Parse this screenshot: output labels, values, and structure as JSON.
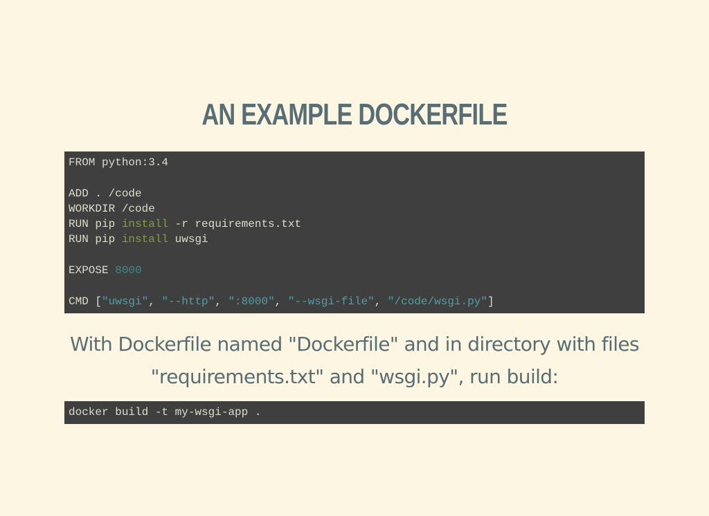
{
  "slide": {
    "title": "AN EXAMPLE DOCKERFILE",
    "paragraph": "With Dockerfile named \"Dockerfile\" and in directory with files \"requirements.txt\" and \"wsgi.py\", run build:"
  },
  "dockerfile": {
    "line1": "FROM python:3.4",
    "line3": "ADD . /code",
    "line4": "WORKDIR /code",
    "line5_a": "RUN pip ",
    "line5_b": "install",
    "line5_c": " -r requirements.txt",
    "line6_a": "RUN pip ",
    "line6_b": "install",
    "line6_c": " uwsgi",
    "line8_a": "EXPOSE ",
    "line8_b": "8000",
    "line10_a": "CMD [",
    "line10_s1": "\"uwsgi\"",
    "line10_c1": ", ",
    "line10_s2": "\"--http\"",
    "line10_c2": ", ",
    "line10_s3": "\":8000\"",
    "line10_c3": ", ",
    "line10_s4": "\"--wsgi-file\"",
    "line10_c4": ", ",
    "line10_s5": "\"/code/wsgi.py\"",
    "line10_end": "]"
  },
  "build_command": "docker build -t my-wsgi-app .",
  "colors": {
    "background": "#fdf6e3",
    "text": "#586e75",
    "code_bg": "#3f3f3f",
    "code_fg": "#dcdccc",
    "builtin": "#7f9f3f",
    "number": "#3d8a8a",
    "string": "#4f9fa8"
  }
}
